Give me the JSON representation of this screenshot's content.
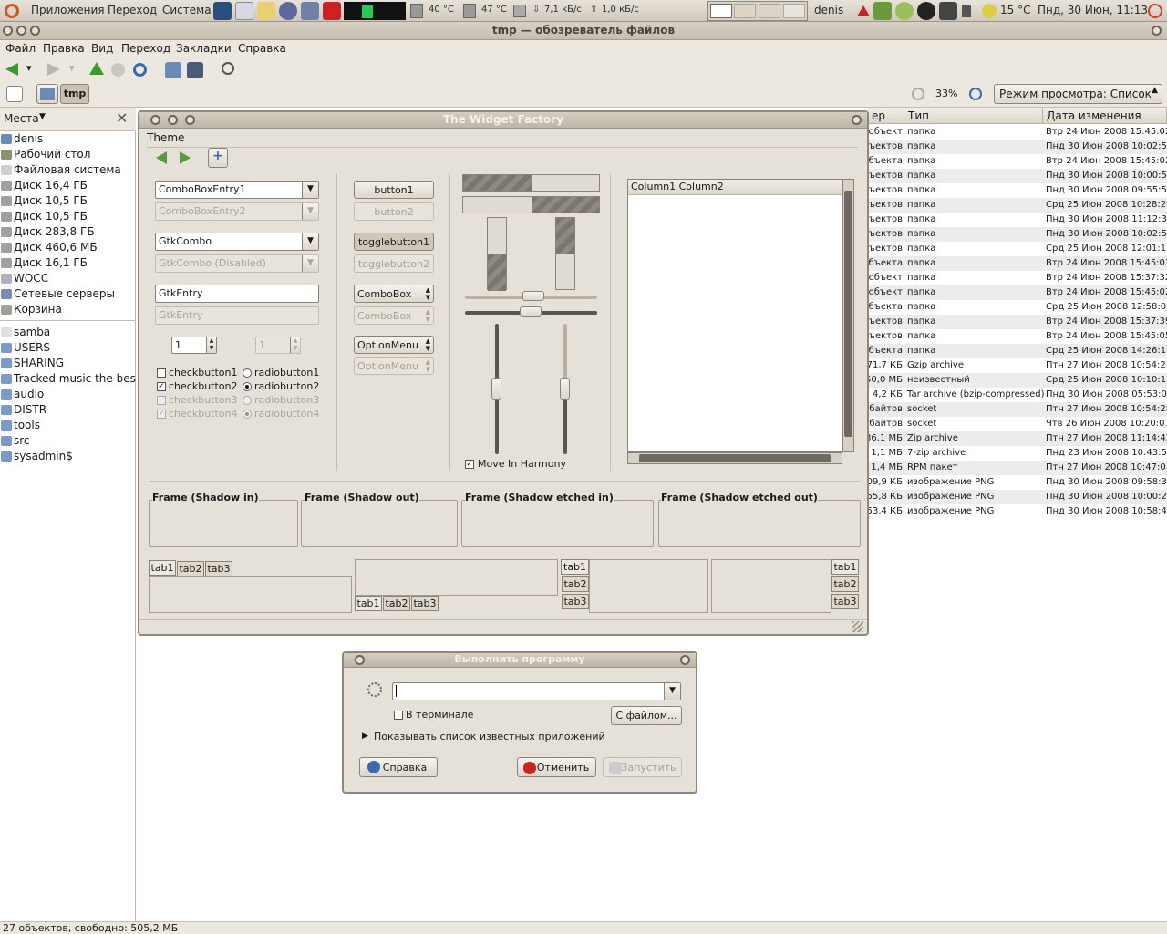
{
  "panel": {
    "menu": [
      "Приложения",
      "Переход",
      "Система"
    ],
    "cpu_temp1": "40 °C",
    "cpu_temp2": "47 °C",
    "net_down": "7,1 кБ/с",
    "net_up": "1,0 кБ/с",
    "user": "denis",
    "weather": "15 °C",
    "clock": "Пнд, 30 Июн, 11:13"
  },
  "window": {
    "title": "tmp — обозреватель файлов",
    "menu": [
      "Файл",
      "Правка",
      "Вид",
      "Переход",
      "Закладки",
      "Справка"
    ],
    "path_button": "tmp",
    "zoom": "33%",
    "view_mode": "Режим просмотра: Список"
  },
  "sidebar": {
    "header": "Места",
    "places": [
      "denis",
      "Рабочий стол",
      "Файловая система",
      "Диск 16,4 ГБ",
      "Диск 10,5 ГБ",
      "Диск 10,5 ГБ",
      "Диск 283,8 ГБ",
      "Диск 460,6 МБ",
      "Диск 16,1 ГБ",
      "WOCC",
      "Сетевые серверы",
      "Корзина"
    ],
    "bookmarks": [
      "samba",
      "USERS",
      "SHARING",
      "Tracked music the best",
      "audio",
      "DISTR",
      "tools",
      "src",
      "sysadmin$"
    ]
  },
  "filelist": {
    "columns": [
      "ер",
      "Тип",
      "Дата изменения"
    ],
    "rows": [
      [
        "объект",
        "папка",
        "Втр 24 Июн 2008 15:45:02"
      ],
      [
        "ъектов",
        "папка",
        "Пнд 30 Июн 2008 10:02:58"
      ],
      [
        "бъекта",
        "папка",
        "Втр 24 Июн 2008 15:45:02"
      ],
      [
        "ъектов",
        "папка",
        "Пнд 30 Июн 2008 10:00:59"
      ],
      [
        "ъектов",
        "папка",
        "Пнд 30 Июн 2008 09:55:55"
      ],
      [
        "ъектов",
        "папка",
        "Срд 25 Июн 2008 10:28:20"
      ],
      [
        "ъектов",
        "папка",
        "Пнд 30 Июн 2008 11:12:31"
      ],
      [
        "ъектов",
        "папка",
        "Пнд 30 Июн 2008 10:02:59"
      ],
      [
        "ъектов",
        "папка",
        "Срд 25 Июн 2008 12:01:12"
      ],
      [
        "бъекта",
        "папка",
        "Втр 24 Июн 2008 15:45:03"
      ],
      [
        "объект",
        "папка",
        "Втр 24 Июн 2008 15:37:32"
      ],
      [
        "объект",
        "папка",
        "Втр 24 Июн 2008 15:45:02"
      ],
      [
        "бъекта",
        "папка",
        "Срд 25 Июн 2008 12:58:01"
      ],
      [
        "ъектов",
        "папка",
        "Втр 24 Июн 2008 15:37:39"
      ],
      [
        "ъектов",
        "папка",
        "Втр 24 Июн 2008 15:45:05"
      ],
      [
        "бъекта",
        "папка",
        "Срд 25 Июн 2008 14:26:18"
      ],
      [
        "71,7 КБ",
        "Gzip archive",
        "Птн 27 Июн 2008 10:54:23"
      ],
      [
        "50,0 МБ",
        "неизвестный",
        "Срд 25 Июн 2008 10:10:12"
      ],
      [
        "4,2 КБ",
        "Tar archive (bzip-compressed)",
        "Пнд 30 Июн 2008 05:53:00"
      ],
      [
        "байтов",
        "socket",
        "Птн 27 Июн 2008 10:54:28"
      ],
      [
        "байтов",
        "socket",
        "Чтв 26 Июн 2008 10:20:07"
      ],
      [
        "36,1 МБ",
        "Zip archive",
        "Птн 27 Июн 2008 11:14:42"
      ],
      [
        "1,1 МБ",
        "7-zip archive",
        "Пнд 23 Июн 2008 10:43:59"
      ],
      [
        "1,4 МБ",
        "RPM пакет",
        "Птн 27 Июн 2008 10:47:01"
      ],
      [
        "09,9 КБ",
        "изображение PNG",
        "Пнд 30 Июн 2008 09:58:35"
      ],
      [
        "55,8 КБ",
        "изображение PNG",
        "Пнд 30 Июн 2008 10:00:27"
      ],
      [
        "53,4 КБ",
        "изображение PNG",
        "Пнд 30 Июн 2008 10:58:48"
      ]
    ]
  },
  "status": "27 объектов, свободно: 505,2 МБ",
  "widget_factory": {
    "title": "The Widget Factory",
    "menu": "Theme",
    "combo1": "ComboBoxEntry1",
    "combo2": "ComboBoxEntry2",
    "gtkcombo": "GtkCombo",
    "gtkcombo_dis": "GtkCombo (Disabled)",
    "entry": "GtkEntry",
    "entry_dis": "GtkEntry",
    "spin1": "1",
    "spin2": "1",
    "check1": "checkbutton1",
    "check2": "checkbutton2",
    "check3": "checkbutton3",
    "check4": "checkbutton4",
    "radio1": "radiobutton1",
    "radio2": "radiobutton2",
    "radio3": "radiobutton3",
    "radio4": "radiobutton4",
    "button1": "button1",
    "button2": "button2",
    "toggle1": "togglebutton1",
    "toggle2": "togglebutton2",
    "combobox": "ComboBox",
    "combobox_dis": "ComboBox",
    "optionmenu": "OptionMenu",
    "optionmenu_dis": "OptionMenu",
    "harmony": "Move In Harmony",
    "tree_header": "Column1 Column2",
    "frames": [
      "Frame (Shadow in)",
      "Frame (Shadow out)",
      "Frame (Shadow etched in)",
      "Frame (Shadow etched out)"
    ],
    "tabs": [
      "tab1",
      "tab2",
      "tab3"
    ]
  },
  "run_dialog": {
    "title": "Выполнить программу",
    "terminal": "В терминале",
    "with_file": "С файлом...",
    "show_list": "Показывать список известных приложений",
    "help": "Справка",
    "cancel": "Отменить",
    "run": "Запустить"
  }
}
